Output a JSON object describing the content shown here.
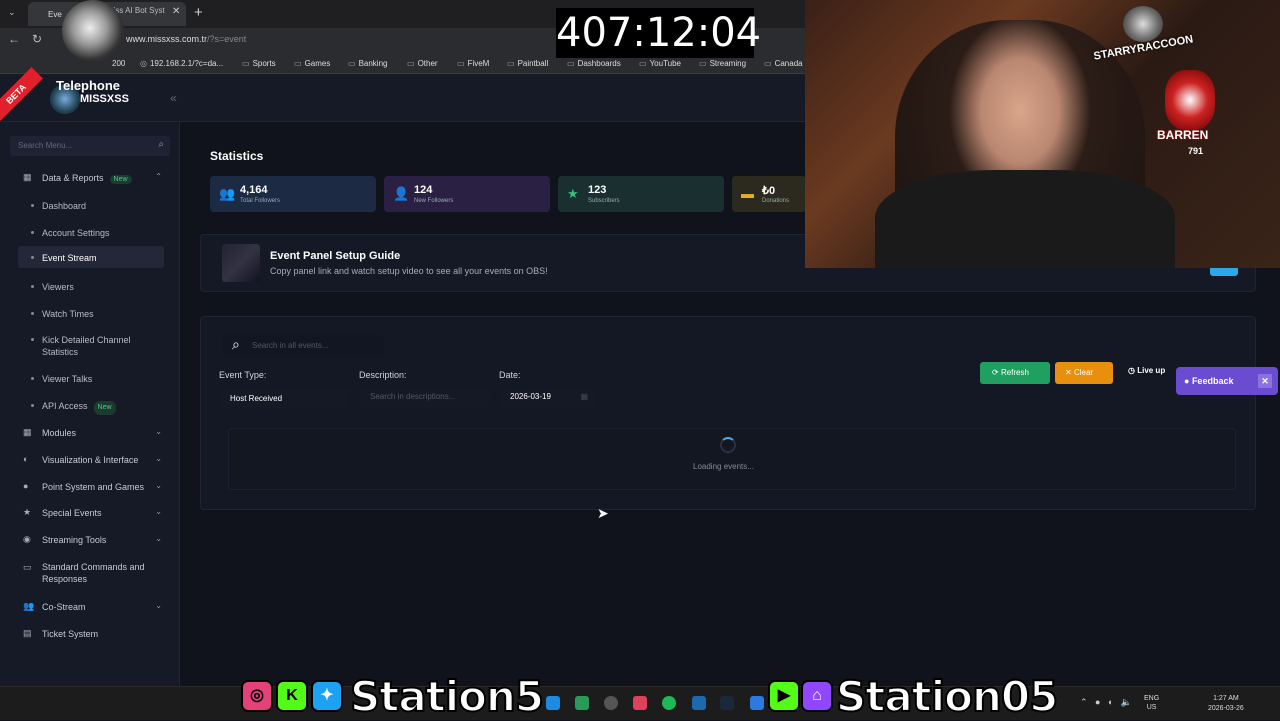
{
  "browser": {
    "tab_title": "Eve",
    "tab2_title": "Xss AI Bot Syst",
    "url_domain": "www.missxss.com.tr",
    "url_path": "/?s=event",
    "bookmarks": [
      "192.168.2.1/?c=da...",
      "Sports",
      "Games",
      "Banking",
      "Other",
      "FiveM",
      "Paintball",
      "Dashboards",
      "YouTube",
      "Streaming",
      "Canada"
    ],
    "bookmark_partial": "200"
  },
  "overlay": {
    "timer": "407:12:04",
    "webcam_logo1": "STARRYRACCOON",
    "webcam_logo2": "BARREN",
    "webcam_logo2_sub": "791",
    "social_left": "Station5",
    "social_right": "Station05"
  },
  "app": {
    "beta": "BETA",
    "brand_title": "Telephone",
    "brand_sub": "MISSXSS",
    "search_menu_placeholder": "Search Menu..."
  },
  "sidebar": {
    "sections": [
      {
        "label": "Data & Reports",
        "badge": "New",
        "icon": "chart-icon",
        "expanded": true
      },
      {
        "label": "Modules",
        "icon": "grid-icon"
      },
      {
        "label": "Visualization & Interface",
        "icon": "palette-icon"
      },
      {
        "label": "Point System and Games",
        "icon": "coin-icon"
      },
      {
        "label": "Special Events",
        "icon": "star-icon"
      },
      {
        "label": "Streaming Tools",
        "icon": "broadcast-icon"
      },
      {
        "label": "Standard Commands and Responses",
        "icon": "keyboard-icon"
      },
      {
        "label": "Co-Stream",
        "icon": "users-icon"
      },
      {
        "label": "Ticket System",
        "icon": "ticket-icon"
      }
    ],
    "sub_items": [
      "Dashboard",
      "Account Settings",
      "Event Stream",
      "Viewers",
      "Watch Times",
      "Kick Detailed Channel Statistics",
      "Viewer Talks",
      "API Access"
    ],
    "sub_badge": "New"
  },
  "statistics": {
    "title": "Statistics",
    "cards": [
      {
        "value": "4,164",
        "label": "Total Followers",
        "icon": "users-icon",
        "color": "#4a8ee8"
      },
      {
        "value": "124",
        "label": "New Followers",
        "icon": "user-plus-icon",
        "color": "#9a6ae8"
      },
      {
        "value": "123",
        "label": "Subscribers",
        "icon": "star-icon",
        "color": "#3ac07a"
      },
      {
        "value": "₺0",
        "label": "Donations",
        "icon": "wallet-icon",
        "color": "#e8b020"
      }
    ]
  },
  "guide": {
    "title": "Event Panel Setup Guide",
    "subtitle": "Copy panel link and watch setup video to see all your events on OBS!"
  },
  "events": {
    "search_placeholder": "Search in all events...",
    "type_label": "Event Type:",
    "type_value": "Host Received",
    "desc_label": "Description:",
    "desc_placeholder": "Search in descriptions...",
    "date_label": "Date:",
    "date_value": "2026-03-19",
    "refresh": "Refresh",
    "clear": "Clear",
    "live": "Live up",
    "feedback": "Feedback",
    "loading": "Loading events..."
  },
  "taskbar": {
    "lang1": "ENG",
    "lang2": "US",
    "time": "1:27 AM",
    "date": "2026-03-26"
  }
}
